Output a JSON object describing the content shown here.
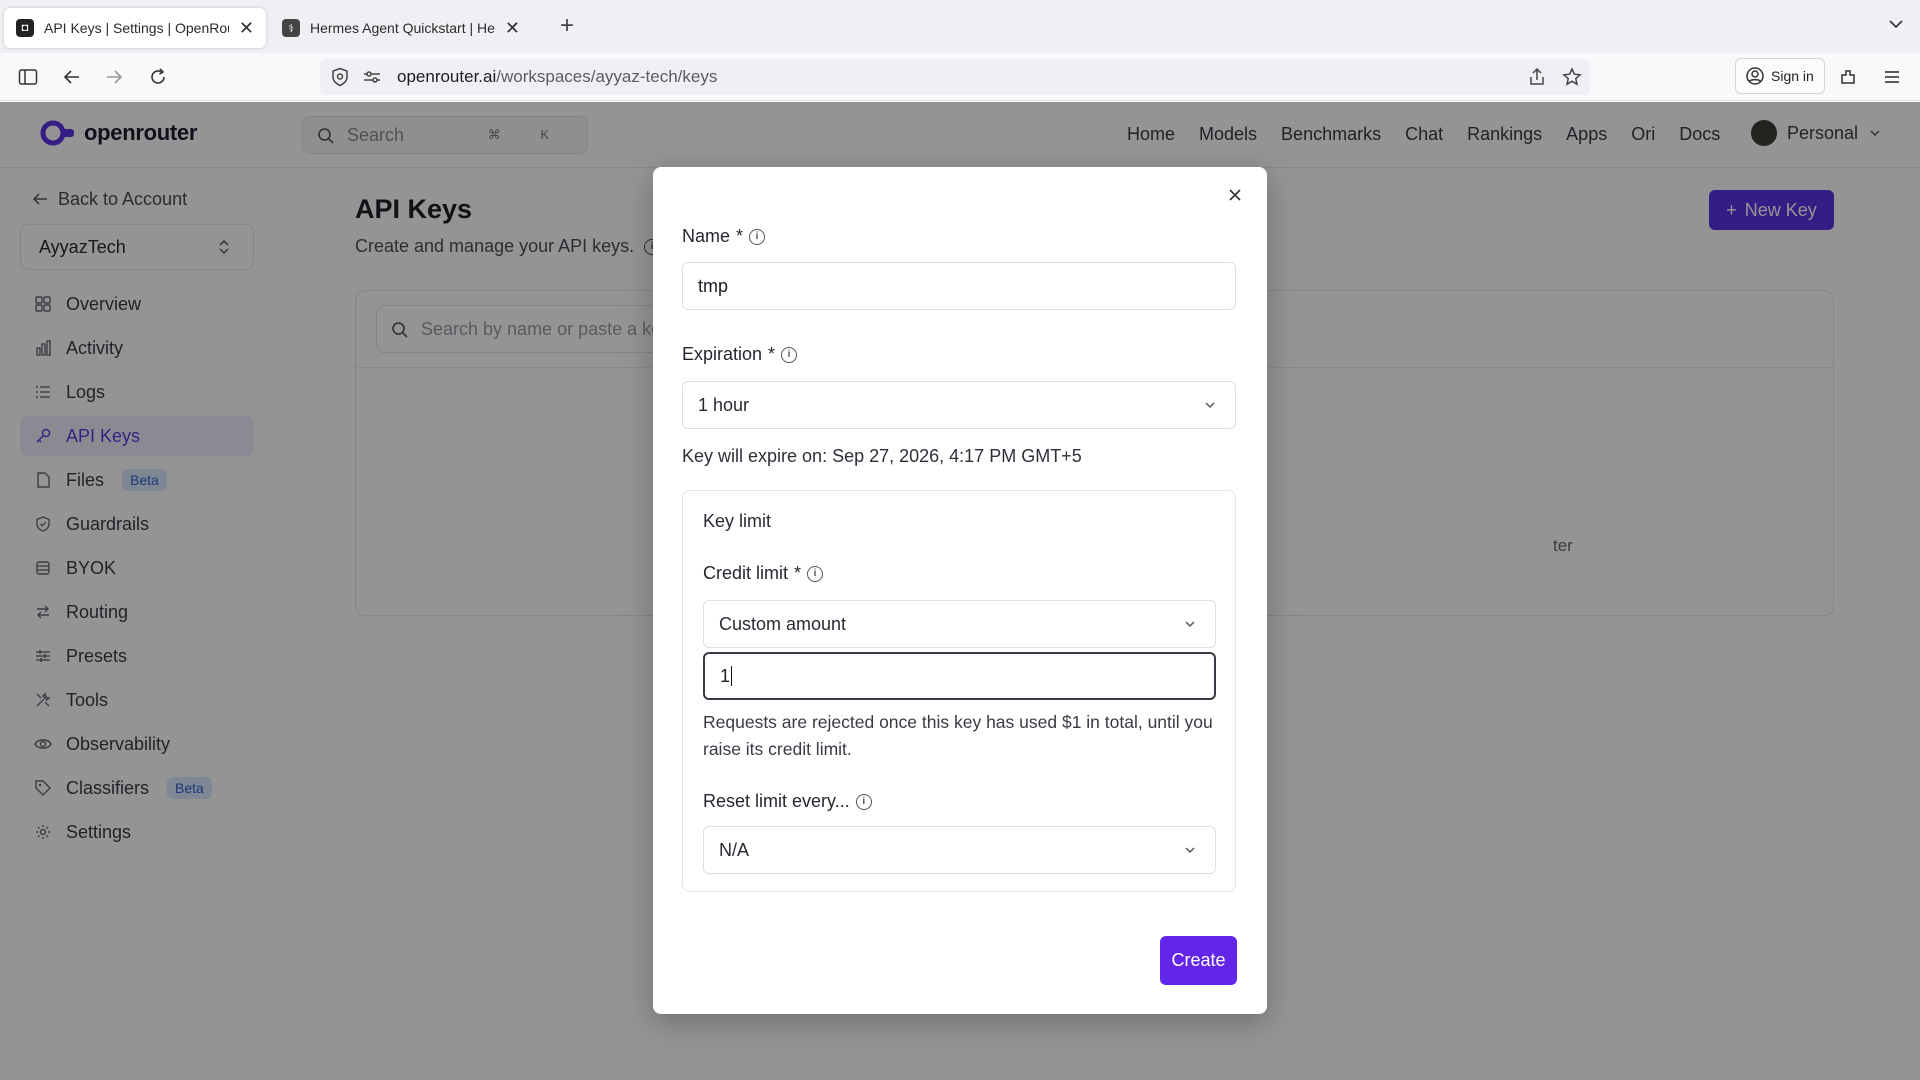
{
  "browser": {
    "tabs": [
      {
        "title": "API Keys | Settings | OpenRouter",
        "active": true
      },
      {
        "title": "Hermes Agent Quickstart | Hermes",
        "active": false
      }
    ],
    "url_host": "openrouter.ai",
    "url_path": "/workspaces/ayyaz-tech/keys",
    "signin_label": "Sign in"
  },
  "header": {
    "logo_text": "openrouter",
    "search_placeholder": "Search",
    "search_shortcut": "⌘ K",
    "nav": [
      "Home",
      "Models",
      "Benchmarks",
      "Chat",
      "Rankings",
      "Apps",
      "Ori",
      "Docs"
    ],
    "account_label": "Personal"
  },
  "sidebar": {
    "back_label": "Back to Account",
    "workspace": "AyyazTech",
    "items": [
      {
        "label": "Overview",
        "icon": "grid-icon"
      },
      {
        "label": "Activity",
        "icon": "bar-chart-icon"
      },
      {
        "label": "Logs",
        "icon": "list-icon"
      },
      {
        "label": "API Keys",
        "icon": "key-icon",
        "active": true
      },
      {
        "label": "Files",
        "icon": "file-icon",
        "badge": "Beta"
      },
      {
        "label": "Guardrails",
        "icon": "shield-icon"
      },
      {
        "label": "BYOK",
        "icon": "database-icon"
      },
      {
        "label": "Routing",
        "icon": "arrows-icon"
      },
      {
        "label": "Presets",
        "icon": "sliders-icon"
      },
      {
        "label": "Tools",
        "icon": "tools-icon"
      },
      {
        "label": "Observability",
        "icon": "eye-icon"
      },
      {
        "label": "Classifiers",
        "icon": "tag-icon",
        "badge": "Beta"
      },
      {
        "label": "Settings",
        "icon": "gear-icon"
      }
    ]
  },
  "main": {
    "title": "API Keys",
    "subtitle": "Create and manage your API keys.",
    "new_key_label": "New Key",
    "search_placeholder": "Search by name or paste a key",
    "empty_fragment": "ter"
  },
  "modal": {
    "name_label": "Name",
    "name_value": "tmp",
    "expiration_label": "Expiration",
    "expiration_value": "1 hour",
    "expire_note": "Key will expire on: Sep 27, 2026, 4:17 PM GMT+5",
    "key_limit_title": "Key limit",
    "credit_limit_label": "Credit limit",
    "credit_limit_select": "Custom amount",
    "credit_amount_value": "1",
    "help_text": "Requests are rejected once this key has used $1 in total, until you raise its credit limit.",
    "reset_label": "Reset limit every...",
    "reset_value": "N/A",
    "create_label": "Create",
    "required_mark": "*"
  },
  "colors": {
    "accent": "#5b34e6",
    "create_button": "#6226e8",
    "sidebar_active_bg": "#eeeefb",
    "badge_bg": "#dbe8ff"
  }
}
